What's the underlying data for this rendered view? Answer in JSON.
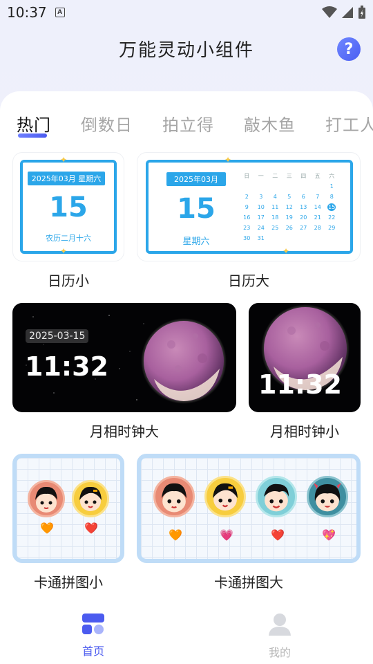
{
  "status": {
    "time": "10:37",
    "a_icon": "A"
  },
  "header": {
    "title": "万能灵动小组件",
    "help_icon": "?"
  },
  "tabs": [
    {
      "label": "热门",
      "active": true
    },
    {
      "label": "倒数日"
    },
    {
      "label": "拍立得"
    },
    {
      "label": "敲木鱼"
    },
    {
      "label": "打工人"
    }
  ],
  "widgets": {
    "cal_small": {
      "label": "日历小",
      "chip": "2025年03月 星期六",
      "day": "15",
      "lunar": "农历二月十六"
    },
    "cal_large": {
      "label": "日历大",
      "chip": "2025年03月",
      "day": "15",
      "weekday": "星期六",
      "week_headers": [
        "日",
        "一",
        "二",
        "三",
        "四",
        "五",
        "六"
      ],
      "cells": [
        "",
        "",
        "",
        "",
        "",
        "",
        "1",
        "2",
        "3",
        "4",
        "5",
        "6",
        "7",
        "8",
        "9",
        "10",
        "11",
        "12",
        "13",
        "14",
        "15",
        "16",
        "17",
        "18",
        "19",
        "20",
        "21",
        "22",
        "23",
        "24",
        "25",
        "26",
        "27",
        "28",
        "29",
        "30",
        "31",
        "",
        "",
        "",
        "",
        ""
      ],
      "today": "15"
    },
    "moon_large": {
      "label": "月相时钟大",
      "date": "2025-03-15",
      "time": "11:32"
    },
    "moon_small": {
      "label": "月相时钟小",
      "time": "11:32"
    },
    "toon_small": {
      "label": "卡通拼图小",
      "hearts": [
        "🧡",
        "❤️"
      ]
    },
    "toon_large": {
      "label": "卡通拼图大",
      "hearts": [
        "🧡",
        "💗",
        "❤️",
        "💖"
      ]
    }
  },
  "nav": [
    {
      "label": "首页",
      "active": true,
      "icon": "home-grid-icon"
    },
    {
      "label": "我的",
      "active": false,
      "icon": "profile-icon"
    }
  ],
  "colors": {
    "accent": "#4b5bef",
    "calendar": "#2ba6e9",
    "inactive": "#a6a6a6"
  }
}
